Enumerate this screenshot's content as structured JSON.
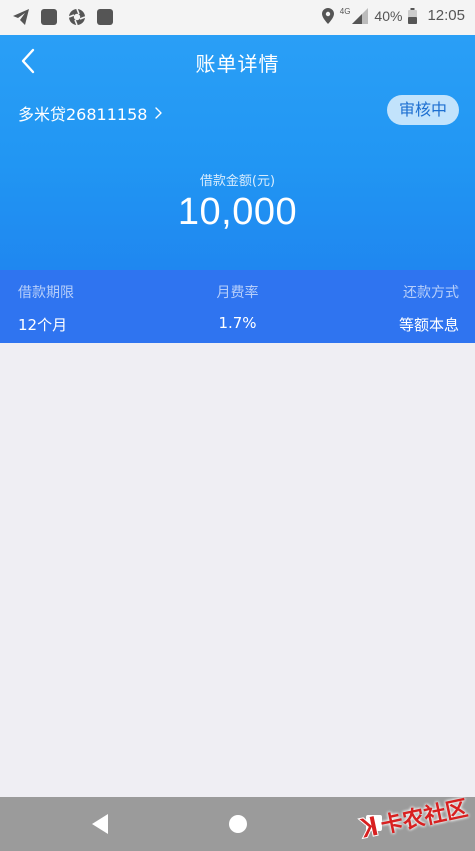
{
  "status_bar": {
    "battery": "40%",
    "time": "12:05",
    "network": "4G"
  },
  "header": {
    "title": "账单详情",
    "account": "多米贷26811158",
    "status_badge": "审核中",
    "amount_label": "借款金额(元)",
    "amount_value": "10,000"
  },
  "info": {
    "term_label": "借款期限",
    "term_value": "12个月",
    "rate_label": "月费率",
    "rate_value": "1.7%",
    "method_label": "还款方式",
    "method_value": "等额本息"
  },
  "watermark": {
    "text": "卡农社区"
  },
  "colors": {
    "header_blue": "#2196f3",
    "info_row_blue": "#2f74f0",
    "background": "#efeef3",
    "nav_gray": "#9b9b9b"
  }
}
